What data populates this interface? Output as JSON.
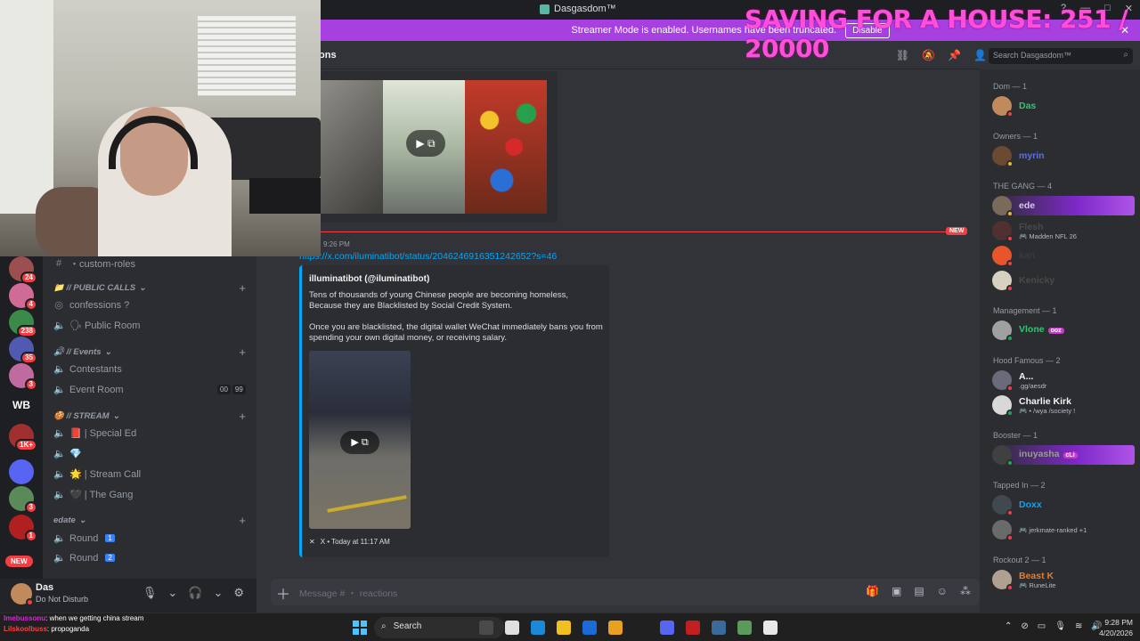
{
  "window": {
    "title": "Dasgasdom™",
    "controls": [
      "?",
      "—",
      "□",
      "✕"
    ]
  },
  "overlay": {
    "text": "SAVING FOR A HOUSE: 251 / 20000"
  },
  "banner": {
    "message": "Streamer Mode is enabled. Usernames have been truncated.",
    "button": "Disable"
  },
  "channel_header": {
    "name": "ons"
  },
  "search": {
    "placeholder": "Search Dasgasdom™"
  },
  "servers": [
    {
      "color": "#9b4f4f",
      "badge": "24"
    },
    {
      "color": "#d06a96",
      "badge": "4"
    },
    {
      "color": "#3c8a4a",
      "badge": "238"
    },
    {
      "color": "#505ab0",
      "badge": "35"
    },
    {
      "color": "#c06aa0",
      "badge": "3"
    },
    {
      "color": "#a03030",
      "badge": "1K+"
    },
    {
      "color": "#5865f2",
      "badge": ""
    },
    {
      "color": "#5a8a5a",
      "badge": "3"
    },
    {
      "color": "#b02020",
      "badge": "1"
    }
  ],
  "server_wb": "WB",
  "new_pill": "NEW",
  "channels": {
    "rows": [
      {
        "glyph": "#",
        "label": "・custom-roles"
      },
      {
        "category": "📁 // PUBLIC CALLS"
      },
      {
        "glyph": "◎",
        "label": "confessions ?"
      },
      {
        "glyph": "🔈",
        "label": "🗣 Public Room"
      },
      {
        "category": "🔊 // Events"
      },
      {
        "glyph": "🔈",
        "label": "Contestants"
      },
      {
        "glyph": "🔈",
        "label": "Event Room"
      },
      {
        "category": "🍪 // STREAM"
      },
      {
        "glyph": "🔈",
        "label": "📕 | Special Ed"
      },
      {
        "glyph": "🔈",
        "label": "💎"
      },
      {
        "glyph": "🔈",
        "label": "🌟 | Stream Call"
      },
      {
        "glyph": "🔈",
        "label": "🖤 | The Gang"
      },
      {
        "category": "edate"
      },
      {
        "glyph": "🔈",
        "label": "Round",
        "num": "1"
      },
      {
        "glyph": "🔈",
        "label": "Round",
        "num": "2"
      }
    ],
    "event_room_counts": [
      "00",
      "99"
    ]
  },
  "user": {
    "name": "Das",
    "status": "Do Not Disturb"
  },
  "chat": {
    "new_label": "NEW",
    "time": "9:26 PM",
    "link": "https://x.com/iluminatibot/status/2046246916351242652?s=46",
    "embed": {
      "author": "illuminatibot (@iluminatibot)",
      "para1": "Tens of thousands of young Chinese people are becoming homeless, Because they are Blacklisted by Social Credit System.",
      "para2": "Once you are blacklisted, the digital wallet WeChat immediately bans you from spending your own digital money, or receiving salary.",
      "footer": "X • Today at 11:17 AM"
    },
    "composer_placeholder": "Message # ・ reactions"
  },
  "members": [
    {
      "group": "Dom — 1",
      "users": [
        {
          "name": "Das",
          "color": "#2dc770",
          "sub": "",
          "avatar": "#c08a5c",
          "status": "#f23f43"
        }
      ]
    },
    {
      "group": "Owners — 1",
      "users": [
        {
          "name": "myrin",
          "color": "#5a6ef2",
          "sub": "",
          "avatar": "#6b4a32",
          "status": "#f0b232"
        }
      ]
    },
    {
      "group": "THE GANG — 4",
      "users": [
        {
          "name": "ede",
          "color": "#d8c8f0",
          "sub": "",
          "avatar": "#7a6a5a",
          "status": "#f0b232",
          "highlight": true
        },
        {
          "name": "Flesh",
          "color": "#4a4a4a",
          "sub": "🎮 Madden NFL 26",
          "avatar": "#503030",
          "status": "#f23f43"
        },
        {
          "name": "kan",
          "color": "#3a3a3a",
          "sub": "",
          "avatar": "#e8552a",
          "status": "#f23f43"
        },
        {
          "name": "Kenicky",
          "color": "#4a4a4a",
          "sub": "",
          "avatar": "#d8d0c0",
          "status": "#f23f43"
        }
      ]
    },
    {
      "group": "Management — 1",
      "users": [
        {
          "name": "Vlone",
          "color": "#2dc770",
          "sub": "",
          "tag": "ooz",
          "avatar": "#a0a0a0",
          "status": "#23a55a"
        }
      ]
    },
    {
      "group": "Hood Famous — 2",
      "users": [
        {
          "name": "A...",
          "color": "#f2f3f5",
          "sub": ".gg/aesdr",
          "avatar": "#6a6a7a",
          "status": "#f23f43"
        },
        {
          "name": "Charlie Kirk",
          "color": "#f2f3f5",
          "sub": "🎮 • /wya /society !",
          "avatar": "#d8d8d8",
          "status": "#23a55a"
        }
      ]
    },
    {
      "group": "Booster — 1",
      "users": [
        {
          "name": "inuyasha",
          "color": "#9a9a9a",
          "sub": "",
          "tag": "cLi",
          "avatar": "#404040",
          "status": "#23a55a",
          "highlight": true
        }
      ]
    },
    {
      "group": "Tapped In — 2",
      "users": [
        {
          "name": "Doxx",
          "color": "#00a8fc",
          "sub": "",
          "avatar": "#404850",
          "status": "#f23f43"
        },
        {
          "name": "",
          "color": "#f2f3f5",
          "sub": "🎮 jerkmate-ranked +1",
          "avatar": "#6a6a6a",
          "status": "#f23f43"
        }
      ]
    },
    {
      "group": "Rockout 2 — 1",
      "users": [
        {
          "name": "Beast K",
          "color": "#e87a2a",
          "sub": "🎮 RuneLite",
          "avatar": "#b0a090",
          "status": "#f23f43"
        }
      ]
    }
  ],
  "chatlog": [
    {
      "user": "Imebussonu",
      "msg": ": when we getting china stream",
      "cls": "u1"
    },
    {
      "user": "Lilskoolbuss",
      "msg": ": propoganda",
      "cls": "u2"
    }
  ],
  "taskbar": {
    "search": "Search",
    "time": "9:28 PM",
    "date": "4/20/2026",
    "apps": [
      "#4a4a4a",
      "#e0e0e0",
      "#1a8ad8",
      "#f0c020",
      "#1a6ad8",
      "#e8a020",
      "#202020",
      "#5865f2",
      "#c02020",
      "#3a6a9a",
      "#5a9a5a",
      "#e8e8e8"
    ]
  }
}
